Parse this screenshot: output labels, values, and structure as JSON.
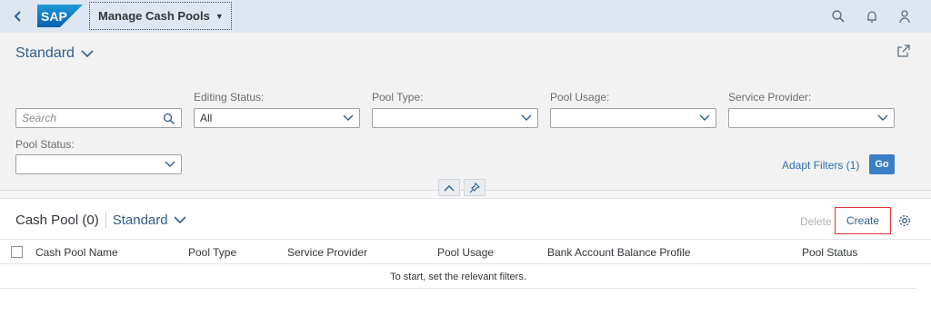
{
  "shell": {
    "logo_text": "SAP",
    "app_title": "Manage Cash Pools",
    "icons": [
      "back-icon",
      "search-icon",
      "bell-icon",
      "user-icon"
    ]
  },
  "header": {
    "variant": "Standard",
    "search_placeholder": "Search",
    "filters": [
      {
        "label": "Editing Status:",
        "value": "All"
      },
      {
        "label": "Pool Type:",
        "value": ""
      },
      {
        "label": "Pool Usage:",
        "value": ""
      },
      {
        "label": "Service Provider:",
        "value": ""
      },
      {
        "label": "Pool Status:",
        "value": ""
      }
    ],
    "adapt_filters": "Adapt Filters (1)",
    "go": "Go"
  },
  "table": {
    "title": "Cash Pool (0)",
    "variant": "Standard",
    "delete": "Delete",
    "create": "Create",
    "columns": [
      "Cash Pool Name",
      "Pool Type",
      "Service Provider",
      "Pool Usage",
      "Bank Account Balance Profile",
      "Pool Status"
    ],
    "empty_text": "To start, set the relevant filters."
  },
  "colors": {
    "accent": "#2f5d8b",
    "go_button": "#3a7ec6",
    "highlight": "#e2353a"
  }
}
